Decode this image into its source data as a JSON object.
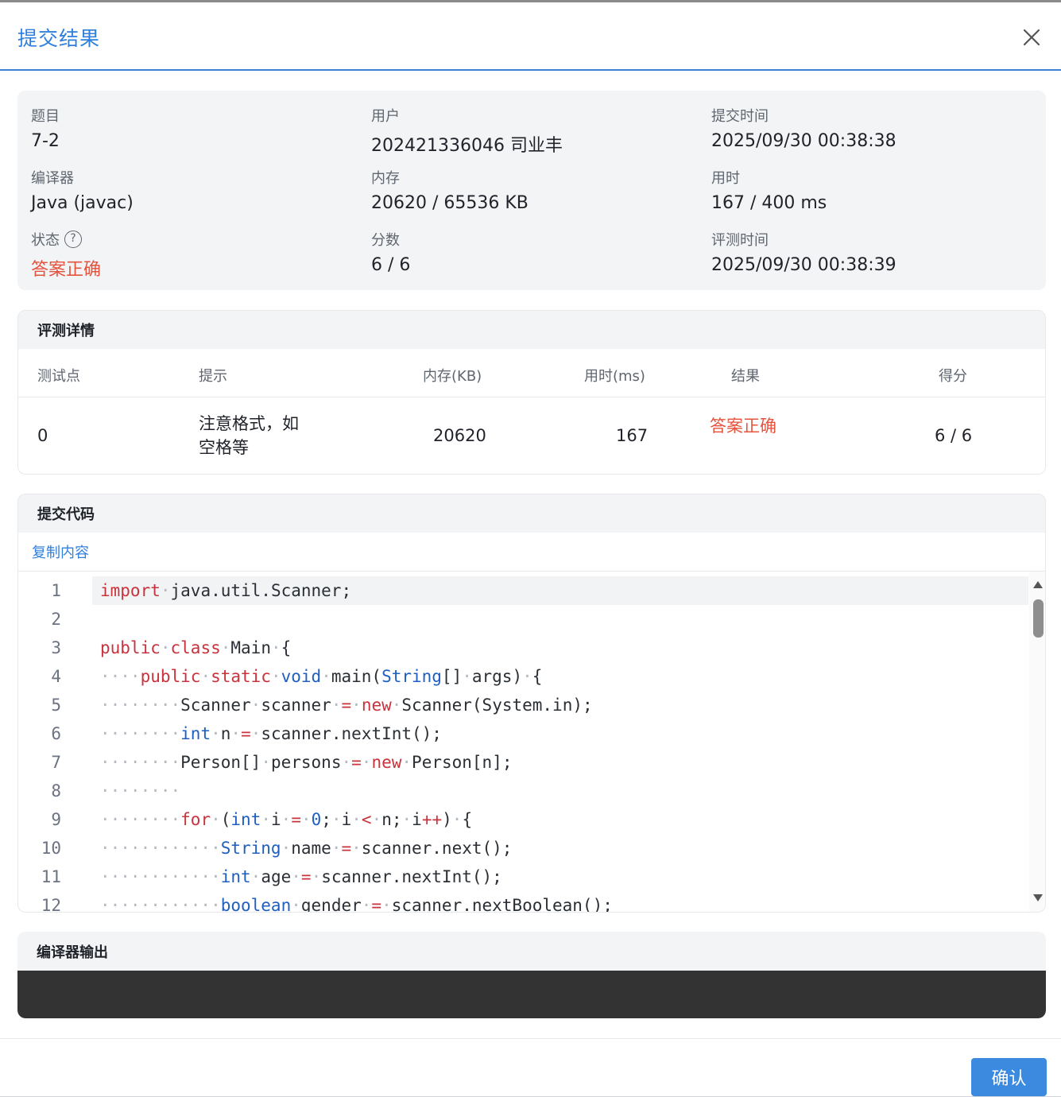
{
  "dialog": {
    "title": "提交结果",
    "confirm_label": "确认"
  },
  "info": {
    "problem": {
      "label": "题目",
      "value": "7-2"
    },
    "user": {
      "label": "用户",
      "value": "202421336046 司业丰"
    },
    "submit_time": {
      "label": "提交时间",
      "value": "2025/09/30 00:38:38"
    },
    "compiler": {
      "label": "编译器",
      "value": "Java (javac)"
    },
    "memory": {
      "label": "内存",
      "value": "20620 / 65536 KB"
    },
    "time_used": {
      "label": "用时",
      "value": "167 / 400 ms"
    },
    "status": {
      "label": "状态",
      "help_icon": "?",
      "value": "答案正确"
    },
    "score": {
      "label": "分数",
      "value": "6 / 6"
    },
    "judge_time": {
      "label": "评测时间",
      "value": "2025/09/30 00:38:39"
    }
  },
  "details": {
    "title": "评测详情",
    "columns": [
      "测试点",
      "提示",
      "内存(KB)",
      "用时(ms)",
      "结果",
      "得分"
    ],
    "rows": [
      {
        "case": "0",
        "hint_line1": "注意格式，如",
        "hint_line2": "空格等",
        "memory": "20620",
        "time": "167",
        "result": "答案正确",
        "score": "6 / 6"
      }
    ]
  },
  "code": {
    "title": "提交代码",
    "copy_label": "复制内容",
    "line_numbers": [
      "1",
      "2",
      "3",
      "4",
      "5",
      "6",
      "7",
      "8",
      "9",
      "10",
      "11",
      "12"
    ]
  },
  "compiler_output": {
    "title": "编译器输出",
    "content": ""
  },
  "colors": {
    "accent": "#2f7fdc",
    "success_text": "#e5533d",
    "console_bg": "#333333"
  },
  "icons": {
    "close": "close-icon",
    "help": "question-circle-icon"
  }
}
